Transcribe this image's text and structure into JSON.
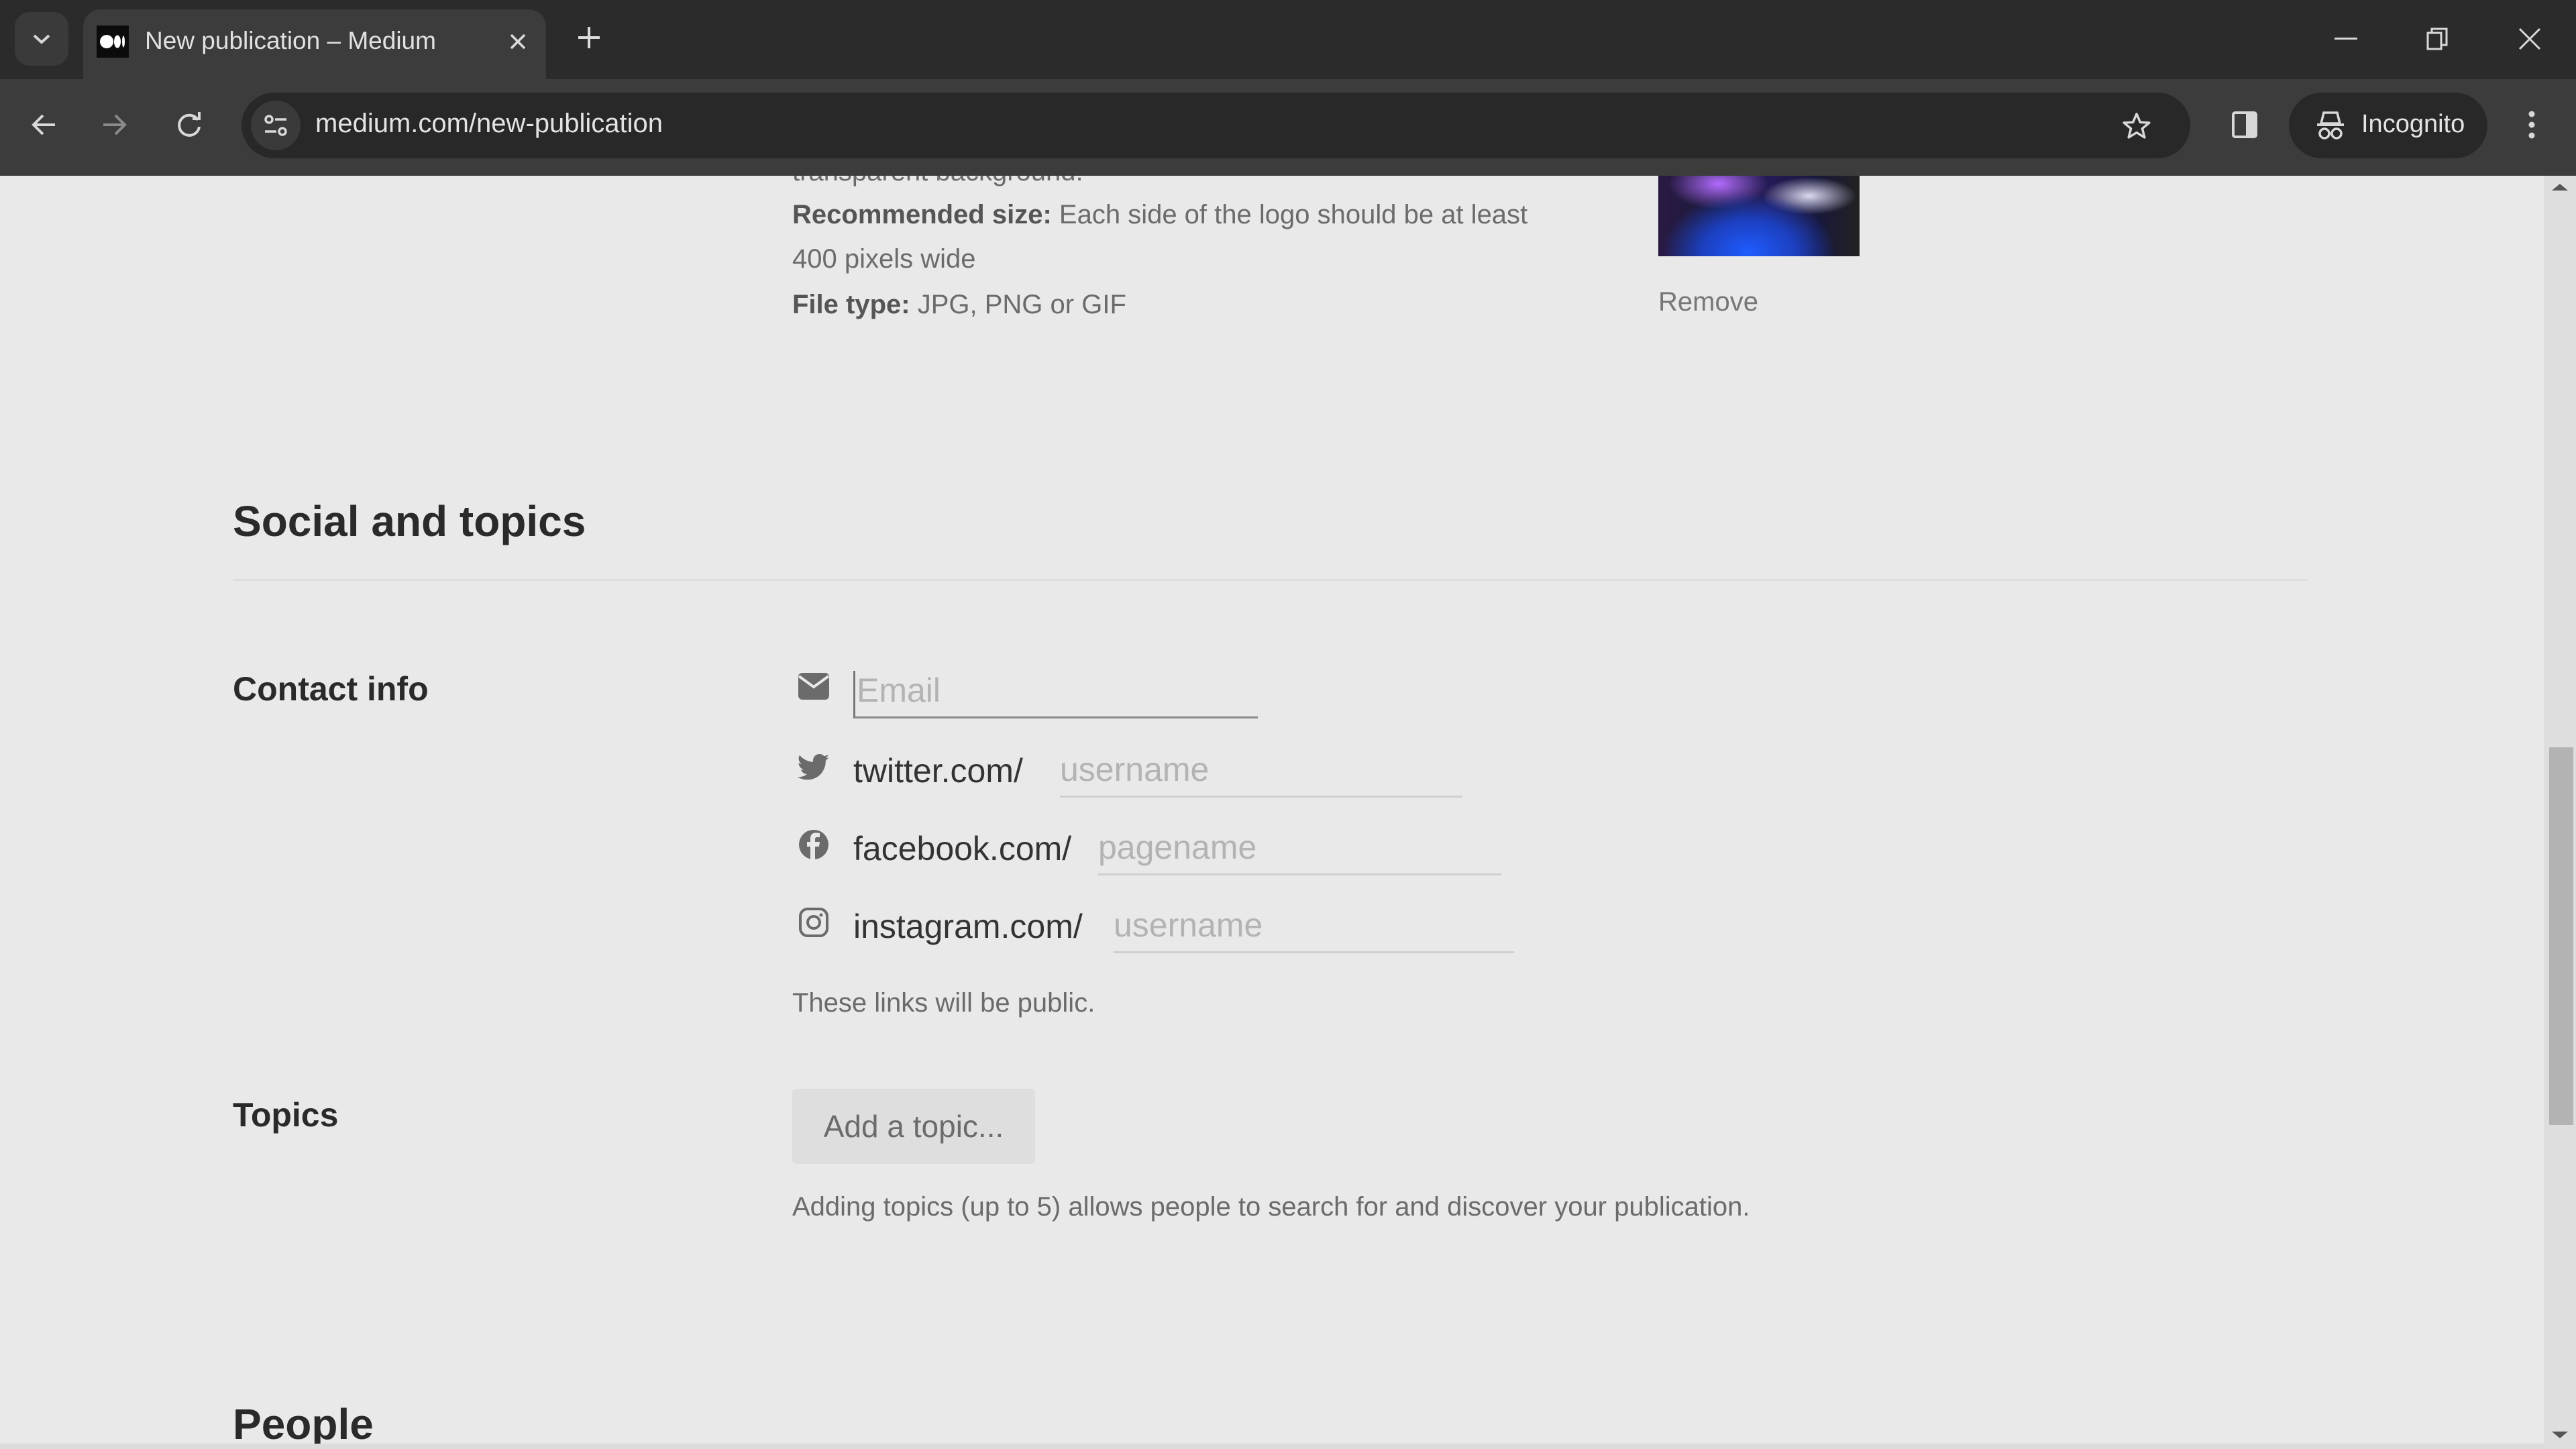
{
  "browser": {
    "tab": {
      "title": "New publication – Medium",
      "favicon": "medium-logo-icon",
      "close_icon": "close-icon"
    },
    "new_tab_icon": "plus-icon",
    "tab_search_icon": "chevron-down-icon",
    "window_controls": {
      "minimize": "minimize-icon",
      "restore": "restore-icon",
      "close": "close-icon"
    },
    "nav": {
      "back": "back-arrow-icon",
      "forward": "forward-arrow-icon",
      "reload": "reload-icon"
    },
    "address_bar": {
      "url": "medium.com/new-publication",
      "site_info_icon": "tune-icon",
      "bookmark_icon": "star-icon"
    },
    "side_panel_icon": "side-panel-icon",
    "profile": {
      "label": "Incognito",
      "icon": "incognito-icon"
    },
    "menu_icon": "kebab-menu-icon"
  },
  "logo_section": {
    "cut_off_text": "transparent background.",
    "recommended_size_label": "Recommended size:",
    "recommended_size_text": "Each side of the logo should be at least",
    "recommended_size_text2": "400 pixels wide",
    "file_type_label": "File type:",
    "file_type_text": "JPG, PNG or GIF",
    "remove_label": "Remove"
  },
  "social_section": {
    "heading": "Social and topics",
    "contact_label": "Contact info",
    "email": {
      "icon": "email-icon",
      "placeholder": "Email",
      "value": ""
    },
    "twitter": {
      "icon": "twitter-icon",
      "prefix": "twitter.com/",
      "placeholder": "username",
      "value": ""
    },
    "facebook": {
      "icon": "facebook-icon",
      "prefix": "facebook.com/",
      "placeholder": "pagename",
      "value": ""
    },
    "instagram": {
      "icon": "instagram-icon",
      "prefix": "instagram.com/",
      "placeholder": "username",
      "value": ""
    },
    "public_note": "These links will be public.",
    "topics_label": "Topics",
    "add_topic_label": "Add a topic...",
    "topics_note": "Adding topics (up to 5) allows people to search for and discover your publication."
  },
  "people_section": {
    "heading": "People"
  },
  "scrollbar": {
    "position_fraction": 0.45,
    "visible_fraction": 0.3
  }
}
